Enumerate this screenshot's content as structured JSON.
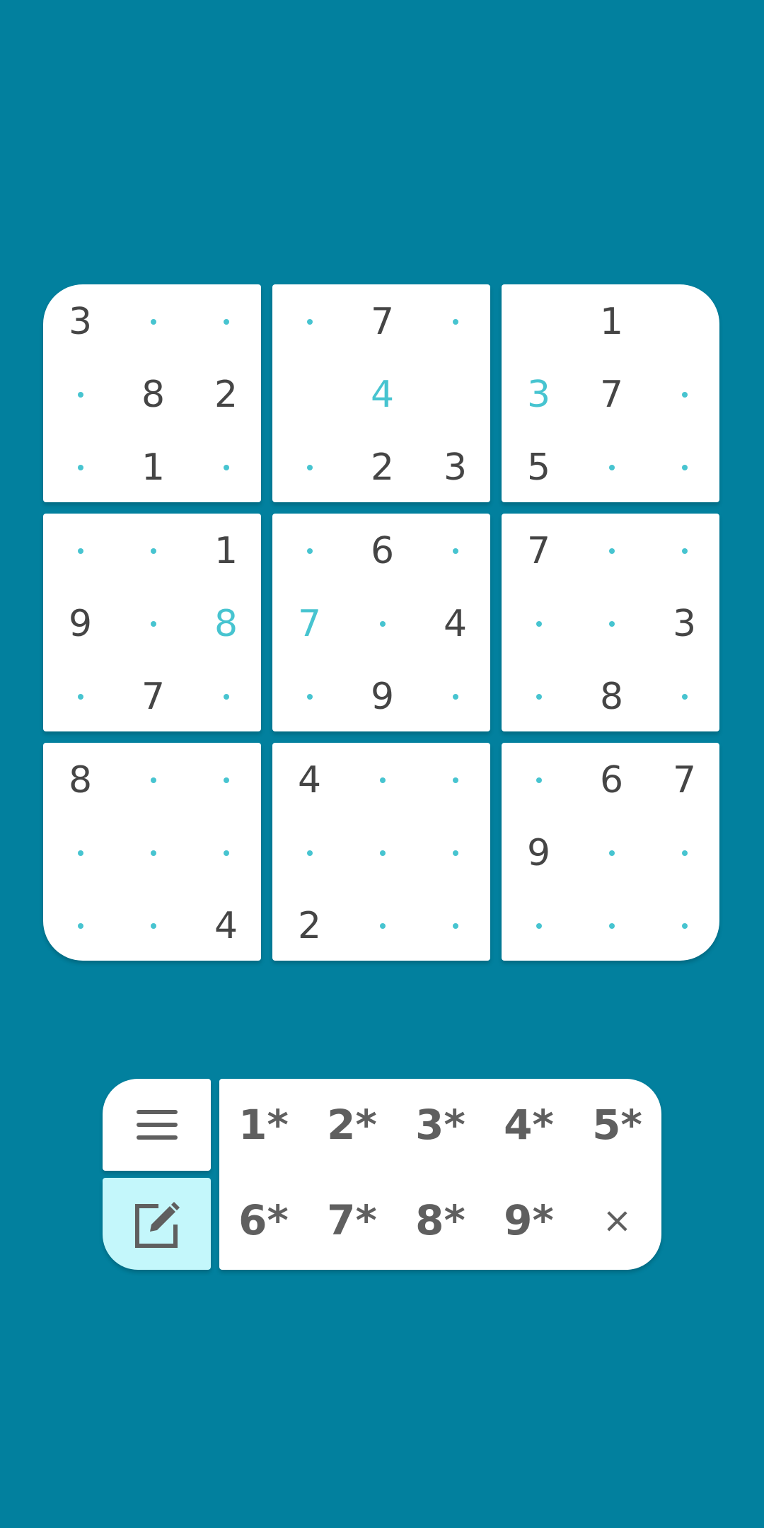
{
  "colors": {
    "background": "#02809e",
    "given_digit": "#454545",
    "entered_digit": "#47c4d0",
    "candidate_dot": "#47c4d0",
    "pencil_active_bg": "#c4f7fb"
  },
  "board": {
    "rows": [
      [
        {
          "v": "3",
          "t": "given"
        },
        {
          "v": "",
          "t": "dot"
        },
        {
          "v": "",
          "t": "dot"
        },
        {
          "v": "",
          "t": "dot"
        },
        {
          "v": "7",
          "t": "given"
        },
        {
          "v": "",
          "t": "dot"
        },
        {
          "v": "",
          "t": "empty"
        },
        {
          "v": "1",
          "t": "given"
        },
        {
          "v": "",
          "t": "empty"
        }
      ],
      [
        {
          "v": "",
          "t": "dot"
        },
        {
          "v": "8",
          "t": "given"
        },
        {
          "v": "2",
          "t": "given"
        },
        {
          "v": "",
          "t": "empty"
        },
        {
          "v": "4",
          "t": "entered"
        },
        {
          "v": "",
          "t": "empty"
        },
        {
          "v": "3",
          "t": "entered"
        },
        {
          "v": "7",
          "t": "given"
        },
        {
          "v": "",
          "t": "dot"
        }
      ],
      [
        {
          "v": "",
          "t": "dot"
        },
        {
          "v": "1",
          "t": "given"
        },
        {
          "v": "",
          "t": "dot"
        },
        {
          "v": "",
          "t": "dot"
        },
        {
          "v": "2",
          "t": "given"
        },
        {
          "v": "3",
          "t": "given"
        },
        {
          "v": "5",
          "t": "given"
        },
        {
          "v": "",
          "t": "dot"
        },
        {
          "v": "",
          "t": "dot"
        }
      ],
      [
        {
          "v": "",
          "t": "dot"
        },
        {
          "v": "",
          "t": "dot"
        },
        {
          "v": "1",
          "t": "given"
        },
        {
          "v": "",
          "t": "dot"
        },
        {
          "v": "6",
          "t": "given"
        },
        {
          "v": "",
          "t": "dot"
        },
        {
          "v": "7",
          "t": "given"
        },
        {
          "v": "",
          "t": "dot"
        },
        {
          "v": "",
          "t": "dot"
        }
      ],
      [
        {
          "v": "9",
          "t": "given"
        },
        {
          "v": "",
          "t": "dot"
        },
        {
          "v": "8",
          "t": "entered"
        },
        {
          "v": "7",
          "t": "entered"
        },
        {
          "v": "",
          "t": "dot"
        },
        {
          "v": "4",
          "t": "given"
        },
        {
          "v": "",
          "t": "dot"
        },
        {
          "v": "",
          "t": "dot"
        },
        {
          "v": "3",
          "t": "given"
        }
      ],
      [
        {
          "v": "",
          "t": "dot"
        },
        {
          "v": "7",
          "t": "given"
        },
        {
          "v": "",
          "t": "dot"
        },
        {
          "v": "",
          "t": "dot"
        },
        {
          "v": "9",
          "t": "given"
        },
        {
          "v": "",
          "t": "dot"
        },
        {
          "v": "",
          "t": "dot"
        },
        {
          "v": "8",
          "t": "given"
        },
        {
          "v": "",
          "t": "dot"
        }
      ],
      [
        {
          "v": "8",
          "t": "given"
        },
        {
          "v": "",
          "t": "dot"
        },
        {
          "v": "",
          "t": "dot"
        },
        {
          "v": "4",
          "t": "given"
        },
        {
          "v": "",
          "t": "dot"
        },
        {
          "v": "",
          "t": "dot"
        },
        {
          "v": "",
          "t": "dot"
        },
        {
          "v": "6",
          "t": "given"
        },
        {
          "v": "7",
          "t": "given"
        }
      ],
      [
        {
          "v": "",
          "t": "dot"
        },
        {
          "v": "",
          "t": "dot"
        },
        {
          "v": "",
          "t": "dot"
        },
        {
          "v": "",
          "t": "dot"
        },
        {
          "v": "",
          "t": "dot"
        },
        {
          "v": "",
          "t": "dot"
        },
        {
          "v": "9",
          "t": "given"
        },
        {
          "v": "",
          "t": "dot"
        },
        {
          "v": "",
          "t": "dot"
        }
      ],
      [
        {
          "v": "",
          "t": "dot"
        },
        {
          "v": "",
          "t": "dot"
        },
        {
          "v": "4",
          "t": "given"
        },
        {
          "v": "2",
          "t": "given"
        },
        {
          "v": "",
          "t": "dot"
        },
        {
          "v": "",
          "t": "dot"
        },
        {
          "v": "",
          "t": "dot"
        },
        {
          "v": "",
          "t": "dot"
        },
        {
          "v": "",
          "t": "dot"
        }
      ]
    ]
  },
  "keypad": {
    "menu_icon": "hamburger-menu-icon",
    "pencil_icon": "pencil-edit-icon",
    "pencil_active": true,
    "keys": [
      "1*",
      "2*",
      "3*",
      "4*",
      "5*",
      "6*",
      "7*",
      "8*",
      "9*",
      "×"
    ]
  }
}
